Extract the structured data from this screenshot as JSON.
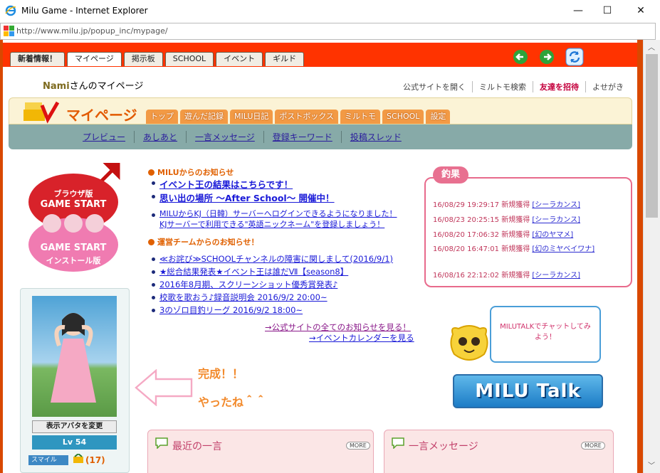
{
  "window": {
    "title": "Milu Game - Internet Explorer",
    "min": "—",
    "max": "☐",
    "close": "✕"
  },
  "address": {
    "url": "http://www.milu.jp/popup_inc/mypage/"
  },
  "tabs": [
    "新着情報！",
    "マイページ",
    "掲示板",
    "SCHOOL",
    "イベント",
    "ギルド"
  ],
  "header": {
    "name": "Nami",
    "suffix": "さんのマイページ",
    "links": [
      "公式サイトを開く",
      "ミルトモ検索",
      "友達を招待",
      "よせがき"
    ]
  },
  "mypage": {
    "title": "マイページ",
    "tabs": [
      "トップ",
      "遊んだ記録",
      "MILU日記",
      "ポストボックス",
      "ミルトモ",
      "SCHOOL",
      "設定"
    ]
  },
  "subnav": [
    "プレビュー",
    "あしあと",
    "一言メッセージ",
    "登録キーワード",
    "投稿スレッド"
  ],
  "start": {
    "line1": "ブラウザ版",
    "line2": "GAME START",
    "line3": "GAME START",
    "line4": "インストール版"
  },
  "news": {
    "heading1": "MILUからのお知らせ",
    "items1": [
      "イベント王の結果はこちらです！",
      "思い出の場所 ～After School～ 開催中！",
      "MILUからKJ（日韓）サーバーへログインできるようになりました！",
      "KJサーバーで利用できる\"英語ニックネーム\"を登録しましょう！"
    ],
    "heading2": "運営チームからのお知らせ！",
    "items2": [
      "≪お詫び≫SCHOOLチャンネルの障害に関しまして(2016/9/1)",
      "★総合結果発表★イベント王は誰だⅦ【season8】",
      "2016年8月期、スクリーンショット優秀賞発表♪",
      "校歌を歌おう♪録音説明会 2016/9/2 20:00~",
      "3のゾロ目釣リーグ 2016/9/2 18:00~"
    ],
    "all_link": "→公式サイトの全てのお知らせを見る！",
    "cal_link": "→イベントカレンダーを見る"
  },
  "fishing": {
    "tag": "釣果",
    "rows": [
      {
        "time": "16/08/29 19:29:17",
        "event": "新規獲得",
        "fish": "[シーラカンス]"
      },
      {
        "time": "16/08/23 20:25:15",
        "event": "新規獲得",
        "fish": "[シーラカンス]"
      },
      {
        "time": "16/08/20 17:06:32",
        "event": "新規獲得",
        "fish": "[幻のヤマメ]"
      },
      {
        "time": "16/08/20 16:47:01",
        "event": "新規獲得",
        "fish": "[幻のミヤベイワナ]"
      },
      {
        "time": "16/08/16 22:12:02",
        "event": "新規獲得",
        "fish": "[シーラカンス]"
      }
    ]
  },
  "avatar": {
    "change": "表示アバタを変更",
    "level": "Lv 54",
    "smile_label": "スマイル",
    "smile_count": "(17)"
  },
  "annotation": {
    "line1": "完成！！",
    "line2": "やったね＾＾"
  },
  "talk": {
    "bubble": "MILUTALKでチャットしてみよう！",
    "button": "MILU Talk"
  },
  "boxes": {
    "recent": "最近の一言",
    "message": "一言メッセージ",
    "more": "MORE"
  }
}
